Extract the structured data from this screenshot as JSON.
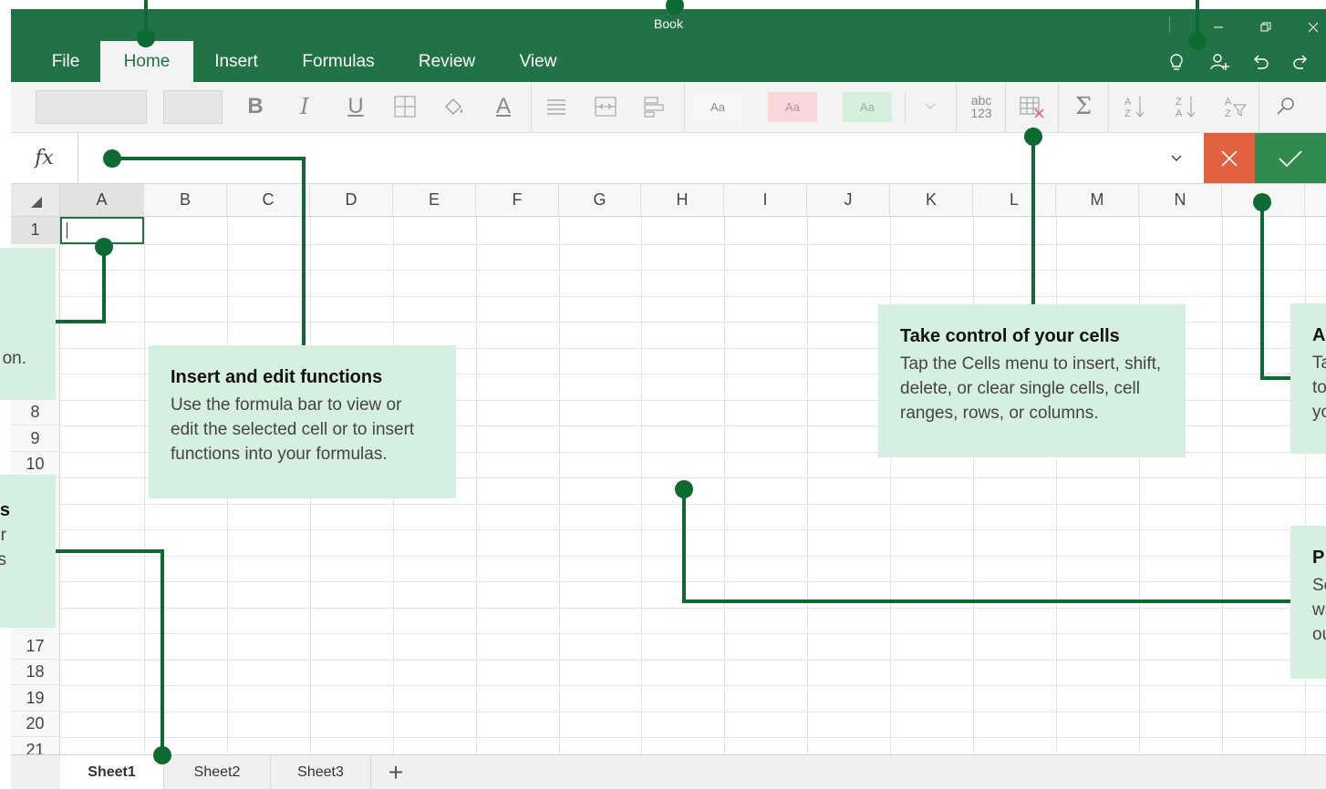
{
  "app": {
    "title": "Book"
  },
  "ribbon": {
    "tabs": [
      {
        "label": "File"
      },
      {
        "label": "Home",
        "active": true
      },
      {
        "label": "Insert"
      },
      {
        "label": "Formulas"
      },
      {
        "label": "Review"
      },
      {
        "label": "View"
      }
    ]
  },
  "toolbar": {
    "bold": "B",
    "italic": "I",
    "underline": "U",
    "font_color": "A",
    "styles": [
      "Aa",
      "Aa",
      "Aa"
    ],
    "number_format_top": "abc",
    "number_format_bottom": "123",
    "autosum": "Σ",
    "font_name_value": "",
    "font_size_value": ""
  },
  "formula_bar": {
    "fx_label": "fx",
    "value": ""
  },
  "grid": {
    "columns": [
      "A",
      "B",
      "C",
      "D",
      "E",
      "F",
      "G",
      "H",
      "I",
      "J",
      "K",
      "L",
      "M",
      "N"
    ],
    "rows": [
      "1",
      "8",
      "9",
      "10",
      "17",
      "18",
      "19",
      "20",
      "21"
    ],
    "active_cell": "A1"
  },
  "sheets": {
    "tabs": [
      "Sheet1",
      "Sheet2",
      "Sheet3"
    ],
    "active": "Sheet1",
    "add_label": "+"
  },
  "callouts": {
    "functions": {
      "title": "Insert and edit functions",
      "body": "Use the formula bar to view or edit the selected cell or to insert functions into your formulas."
    },
    "cells": {
      "title": "Take control of your cells",
      "body": "Tap the Cells menu to insert, shift, delete, or clear single cells, cell ranges, rows, or columns."
    },
    "left_top_fragment": "on.",
    "left_mid_fragment_1": "s",
    "left_mid_fragment_2": "r",
    "left_mid_fragment_3": "s",
    "right_top_fragment_title": "A",
    "right_top_fragment_1": "Ta",
    "right_top_fragment_2": "to",
    "right_top_fragment_3": "yo",
    "right_bottom_fragment_title": "P",
    "right_bottom_fragment_1": "Se",
    "right_bottom_fragment_2": "w",
    "right_bottom_fragment_3": "ou"
  },
  "colors": {
    "brand": "#217346",
    "connector": "#0d6b32",
    "callout_bg": "#d5efe0",
    "cancel": "#e2623f",
    "enter": "#2f8a4f"
  }
}
